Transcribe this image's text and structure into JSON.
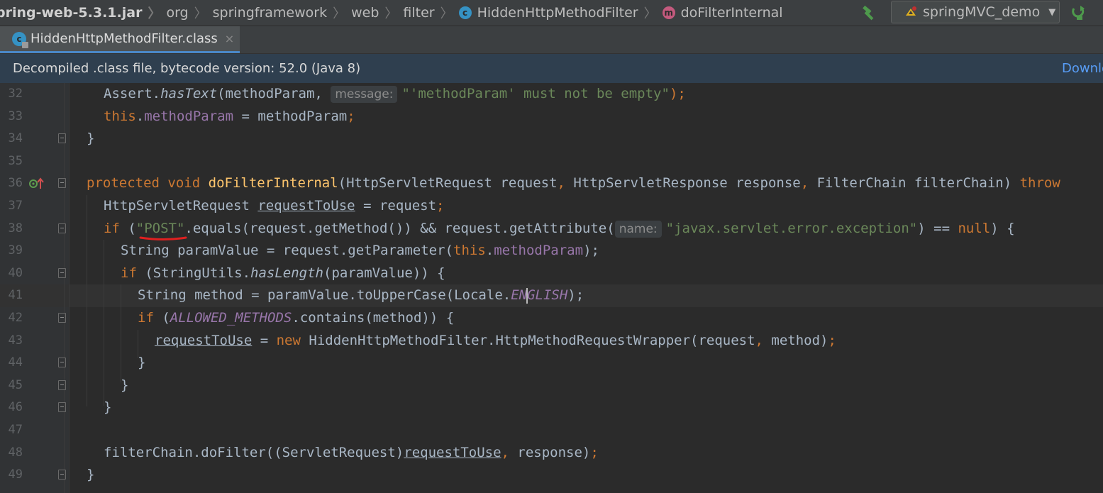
{
  "navbar": {
    "crumbs": [
      "pring-web-5.3.1.jar",
      "org",
      "springframework",
      "web",
      "filter",
      "HiddenHttpMethodFilter",
      "doFilterInternal"
    ],
    "run_config": "springMVC_demo",
    "icons": [
      "hammer-icon",
      "tomcat-icon",
      "chevron-down-icon",
      "rerun-icon"
    ]
  },
  "tab": {
    "label": "HiddenHttpMethodFilter.class",
    "close": "×"
  },
  "banner": {
    "message": "Decompiled .class file, bytecode version: 52.0 (Java 8)",
    "link": "Downlo"
  },
  "editor": {
    "line_numbers": [
      "32",
      "33",
      "34",
      "35",
      "36",
      "37",
      "38",
      "39",
      "40",
      "41",
      "42",
      "43",
      "44",
      "45",
      "46",
      "47",
      "48",
      "49"
    ],
    "current_line": "41",
    "hints": {
      "message": "message:",
      "name": "name:"
    },
    "colors": {
      "keyword": "#cc7832",
      "field": "#9876aa",
      "string": "#6a8759",
      "method": "#ffc66d",
      "text": "#a9b7c6"
    },
    "tokens": {
      "l32": [
        "Assert.",
        "hasText",
        "(methodParam, ",
        "\"'methodParam' must not be empty\"",
        ");"
      ],
      "l33": [
        "this",
        ".",
        "methodParam",
        " = methodParam",
        ";"
      ],
      "l34": [
        "}"
      ],
      "l36": [
        "protected",
        " ",
        "void",
        " ",
        "doFilterInternal",
        "(HttpServletRequest request",
        ",",
        " HttpServletResponse response",
        ",",
        " FilterChain filterChain) ",
        "throw"
      ],
      "l37": [
        "HttpServletRequest ",
        "requestToUse",
        " = request",
        ";"
      ],
      "l38": [
        "if",
        " (",
        "\"POST\"",
        ".equals(request.getMethod()) && request.getAttribute(",
        "\"javax.servlet.error.exception\"",
        ") == ",
        "null",
        ") {"
      ],
      "l39": [
        "String paramValue = request.getParameter(",
        "this",
        ".",
        "methodParam",
        ");"
      ],
      "l40": [
        "if",
        " (StringUtils.",
        "hasLength",
        "(paramValue)) {"
      ],
      "l41": [
        "String method = paramValue.toUpperCase(Locale.",
        "EN",
        "GLISH",
        ");"
      ],
      "l42": [
        "if",
        " (",
        "ALLOWED_METHODS",
        ".contains(method)) {"
      ],
      "l43": [
        "requestToUse",
        " = ",
        "new",
        " HiddenHttpMethodFilter.HttpMethodRequestWrapper(request",
        ",",
        " method)",
        ";"
      ],
      "l44": [
        "}"
      ],
      "l45": [
        "}"
      ],
      "l46": [
        "}"
      ],
      "l48": [
        "filterChain.doFilter((ServletRequest)",
        "requestToUse",
        ",",
        " response)",
        ";"
      ],
      "l49": [
        "}"
      ]
    }
  }
}
